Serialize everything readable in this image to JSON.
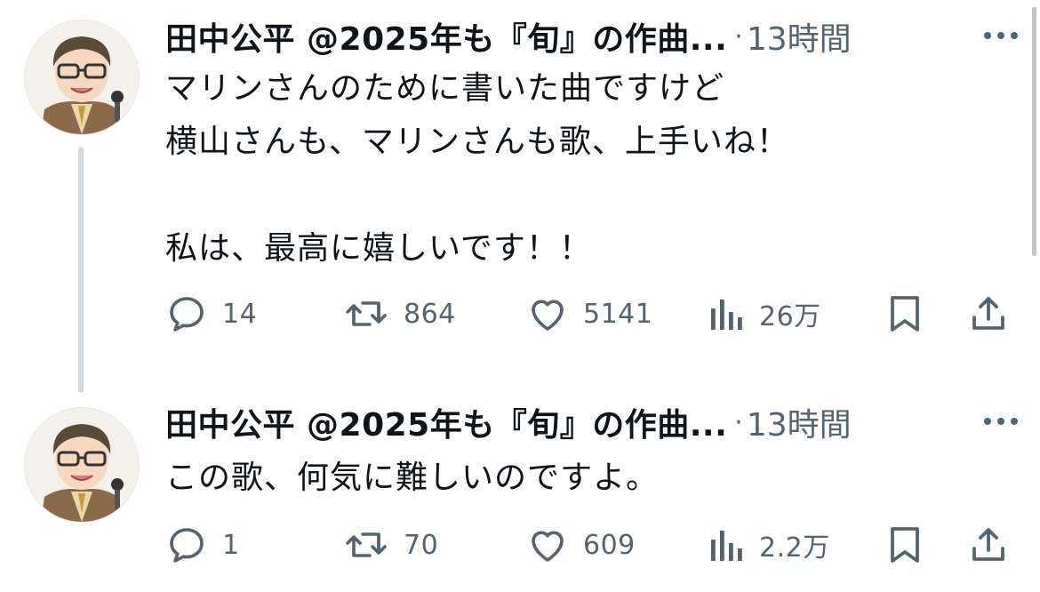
{
  "tweets": [
    {
      "author": {
        "display_name": "田中公平 @2025年も『旬』の作曲..."
      },
      "separator": "·",
      "time": "13時間",
      "body": [
        "マリンさんのために書いた曲ですけど",
        "横山さんも、マリンさんも歌、上手いね！",
        "",
        "私は、最高に嬉しいです！！"
      ],
      "metrics": {
        "replies": "14",
        "retweets": "864",
        "likes": "5141",
        "views": "26万"
      }
    },
    {
      "author": {
        "display_name": "田中公平 @2025年も『旬』の作曲..."
      },
      "separator": "·",
      "time": "13時間",
      "body": [
        "この歌、何気に難しいのですよ。"
      ],
      "metrics": {
        "replies": "1",
        "retweets": "70",
        "likes": "609",
        "views": "2.2万"
      }
    }
  ],
  "icons": {
    "reply": "speech-bubble-icon",
    "retweet": "retweet-arrows-icon",
    "like": "heart-icon",
    "views": "bar-chart-icon",
    "bookmark": "bookmark-icon",
    "share": "share-upload-icon",
    "more": "more-dots-icon"
  },
  "colors": {
    "text_primary": "#0f1419",
    "text_secondary": "#536471",
    "thread_line": "#cfd9de"
  }
}
